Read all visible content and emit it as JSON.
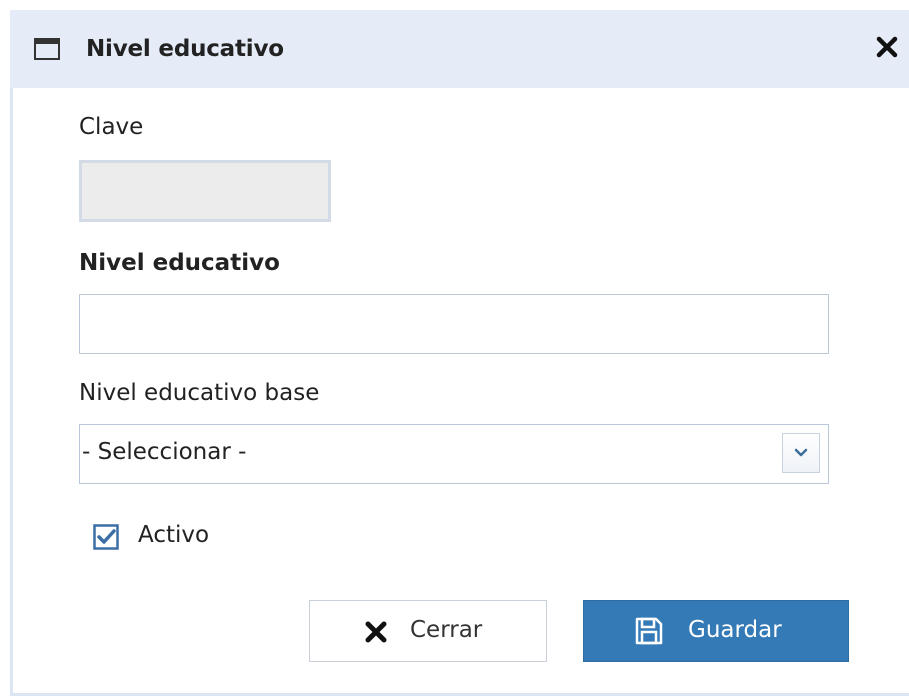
{
  "dialog": {
    "title": "Nivel educativo",
    "icons": {
      "window": "window-icon",
      "close": "close-icon"
    }
  },
  "form": {
    "clave": {
      "label": "Clave",
      "value": ""
    },
    "nivel_educativo": {
      "label": "Nivel educativo",
      "value": "",
      "placeholder": ""
    },
    "nivel_base": {
      "label": "Nivel educativo base",
      "selected": "- Seleccionar -"
    },
    "activo": {
      "label": "Activo",
      "checked": true
    }
  },
  "buttons": {
    "cerrar": {
      "label": "Cerrar",
      "icon": "x-icon"
    },
    "guardar": {
      "label": "Guardar",
      "icon": "floppy-disk-icon"
    }
  },
  "colors": {
    "titlebar": "#e5ecf7",
    "primary": "#337ab7",
    "checkbox": "#3a6ea5"
  }
}
